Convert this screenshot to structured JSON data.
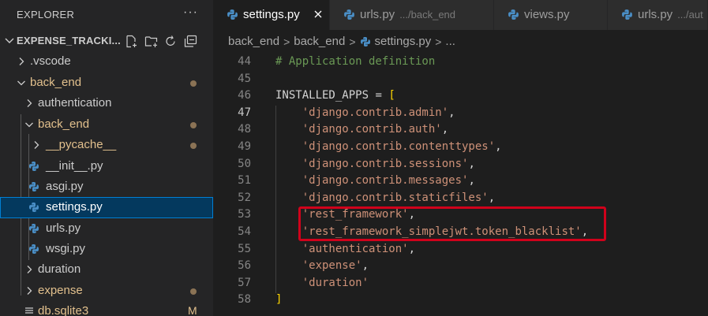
{
  "sidebar": {
    "title": "EXPLORER",
    "more": "···",
    "project": "EXPENSE_TRACKI...",
    "items": [
      {
        "label": ".vscode",
        "kind": "folder",
        "open": false,
        "depth": 1,
        "status": ""
      },
      {
        "label": "back_end",
        "kind": "folder",
        "open": true,
        "depth": 1,
        "status": "dot"
      },
      {
        "label": "authentication",
        "kind": "folder",
        "open": false,
        "depth": 2,
        "status": ""
      },
      {
        "label": "back_end",
        "kind": "folder",
        "open": true,
        "depth": 2,
        "status": "dot"
      },
      {
        "label": "__pycache__",
        "kind": "folder",
        "open": false,
        "depth": 3,
        "status": "dot"
      },
      {
        "label": "__init__.py",
        "kind": "py",
        "depth": 3,
        "status": ""
      },
      {
        "label": "asgi.py",
        "kind": "py",
        "depth": 3,
        "status": ""
      },
      {
        "label": "settings.py",
        "kind": "py",
        "depth": 3,
        "status": "",
        "selected": true
      },
      {
        "label": "urls.py",
        "kind": "py",
        "depth": 3,
        "status": ""
      },
      {
        "label": "wsgi.py",
        "kind": "py",
        "depth": 3,
        "status": ""
      },
      {
        "label": "duration",
        "kind": "folder",
        "open": false,
        "depth": 2,
        "status": ""
      },
      {
        "label": "expense",
        "kind": "folder",
        "open": false,
        "depth": 2,
        "status": "dot"
      },
      {
        "label": "db.sqlite3",
        "kind": "db",
        "depth": 1,
        "status": "M"
      }
    ]
  },
  "tabs": [
    {
      "label": "settings.py",
      "desc": "",
      "active": true
    },
    {
      "label": "urls.py",
      "desc": ".../back_end",
      "active": false
    },
    {
      "label": "views.py",
      "desc": "",
      "active": false
    },
    {
      "label": "urls.py",
      "desc": ".../aut",
      "active": false
    }
  ],
  "breadcrumb": {
    "parts": [
      "back_end",
      "back_end",
      "settings.py",
      "..."
    ],
    "sep": ">"
  },
  "code": {
    "lines": [
      {
        "n": "44",
        "tokens": [
          [
            "comment",
            "# Application definition"
          ]
        ]
      },
      {
        "n": "45",
        "tokens": []
      },
      {
        "n": "46",
        "tokens": [
          [
            "ident",
            "INSTALLED_APPS"
          ],
          [
            "op",
            " = "
          ],
          [
            "brack",
            "["
          ]
        ]
      },
      {
        "n": "47",
        "current": true,
        "tokens": [
          [
            "ws",
            "    "
          ],
          [
            "str",
            "'django.contrib.admin'"
          ],
          [
            "punc",
            ","
          ]
        ]
      },
      {
        "n": "48",
        "tokens": [
          [
            "ws",
            "    "
          ],
          [
            "str",
            "'django.contrib.auth'"
          ],
          [
            "punc",
            ","
          ]
        ]
      },
      {
        "n": "49",
        "tokens": [
          [
            "ws",
            "    "
          ],
          [
            "str",
            "'django.contrib.contenttypes'"
          ],
          [
            "punc",
            ","
          ]
        ]
      },
      {
        "n": "50",
        "tokens": [
          [
            "ws",
            "    "
          ],
          [
            "str",
            "'django.contrib.sessions'"
          ],
          [
            "punc",
            ","
          ]
        ]
      },
      {
        "n": "51",
        "tokens": [
          [
            "ws",
            "    "
          ],
          [
            "str",
            "'django.contrib.messages'"
          ],
          [
            "punc",
            ","
          ]
        ]
      },
      {
        "n": "52",
        "tokens": [
          [
            "ws",
            "    "
          ],
          [
            "str",
            "'django.contrib.staticfiles'"
          ],
          [
            "punc",
            ","
          ]
        ]
      },
      {
        "n": "53",
        "tokens": [
          [
            "ws",
            "    "
          ],
          [
            "str",
            "'rest_framework'"
          ],
          [
            "punc",
            ","
          ]
        ]
      },
      {
        "n": "54",
        "tokens": [
          [
            "ws",
            "    "
          ],
          [
            "str",
            "'rest_framework_simplejwt.token_blacklist'"
          ],
          [
            "punc",
            ","
          ]
        ]
      },
      {
        "n": "55",
        "tokens": [
          [
            "ws",
            "    "
          ],
          [
            "str",
            "'authentication'"
          ],
          [
            "punc",
            ","
          ]
        ]
      },
      {
        "n": "56",
        "tokens": [
          [
            "ws",
            "    "
          ],
          [
            "str",
            "'expense'"
          ],
          [
            "punc",
            ","
          ]
        ]
      },
      {
        "n": "57",
        "tokens": [
          [
            "ws",
            "    "
          ],
          [
            "str",
            "'duration'"
          ]
        ]
      },
      {
        "n": "58",
        "tokens": [
          [
            "brack",
            "]"
          ]
        ]
      }
    ]
  },
  "colors": {
    "accent_selection": "#04395e",
    "focus_border": "#007fd4",
    "annotation_red": "#d0021b",
    "string": "#ce9178",
    "comment": "#6a9955",
    "bracket": "#ffd700",
    "modified": "#e2c08d"
  },
  "icons": {
    "python": "python-file-icon",
    "chevron_right": "chevron-right-icon",
    "chevron_down": "chevron-down-icon",
    "new_file": "new-file-icon",
    "new_folder": "new-folder-icon",
    "refresh": "refresh-icon",
    "collapse": "collapse-all-icon",
    "close": "close-icon",
    "database": "database-file-icon"
  }
}
